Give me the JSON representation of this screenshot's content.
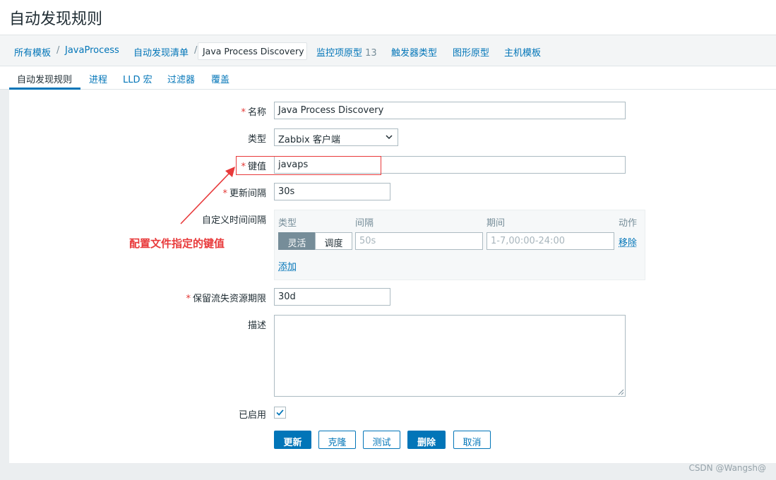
{
  "page": {
    "title": "自动发现规则"
  },
  "breadcrumbs": {
    "all_templates": "所有模板",
    "template": "JavaProcess",
    "discovery_list": "自动发现清单",
    "current": "Java Process Discovery",
    "item_prototypes": "监控项原型",
    "item_prototypes_count": "13",
    "trigger_prototypes": "触发器类型",
    "graph_prototypes": "图形原型",
    "host_prototypes": "主机模板",
    "separator": "/"
  },
  "tabs": {
    "rule": "自动发现规则",
    "process": "进程",
    "lld_macros": "LLD 宏",
    "filters": "过滤器",
    "overrides": "覆盖"
  },
  "form": {
    "required_mark": "*",
    "name_label": "名称",
    "name_value": "Java Process Discovery",
    "type_label": "类型",
    "type_value": "Zabbix 客户端",
    "key_label": "键值",
    "key_value": "javaps",
    "update_interval_label": "更新间隔",
    "update_interval_value": "30s",
    "custom_intervals_label": "自定义时间间隔",
    "custom_intervals": {
      "col_type": "类型",
      "col_interval": "间隔",
      "col_period": "期间",
      "col_action": "动作",
      "type_flexible": "灵活",
      "type_scheduling": "调度",
      "interval_placeholder": "50s",
      "period_placeholder": "1-7,00:00-24:00",
      "remove": "移除",
      "add": "添加"
    },
    "keep_lost_label": "保留流失资源期限",
    "keep_lost_value": "30d",
    "description_label": "描述",
    "description_value": "",
    "enabled_label": "已启用",
    "enabled": true
  },
  "buttons": {
    "update": "更新",
    "clone": "克隆",
    "test": "测试",
    "delete": "删除",
    "cancel": "取消"
  },
  "annotation": {
    "text": "配置文件指定的键值",
    "color": "#e8393a"
  },
  "watermark": "CSDN @Wangsh@",
  "colors": {
    "link": "#0275b8",
    "required": "#e33734",
    "text": "#1f2c33"
  }
}
